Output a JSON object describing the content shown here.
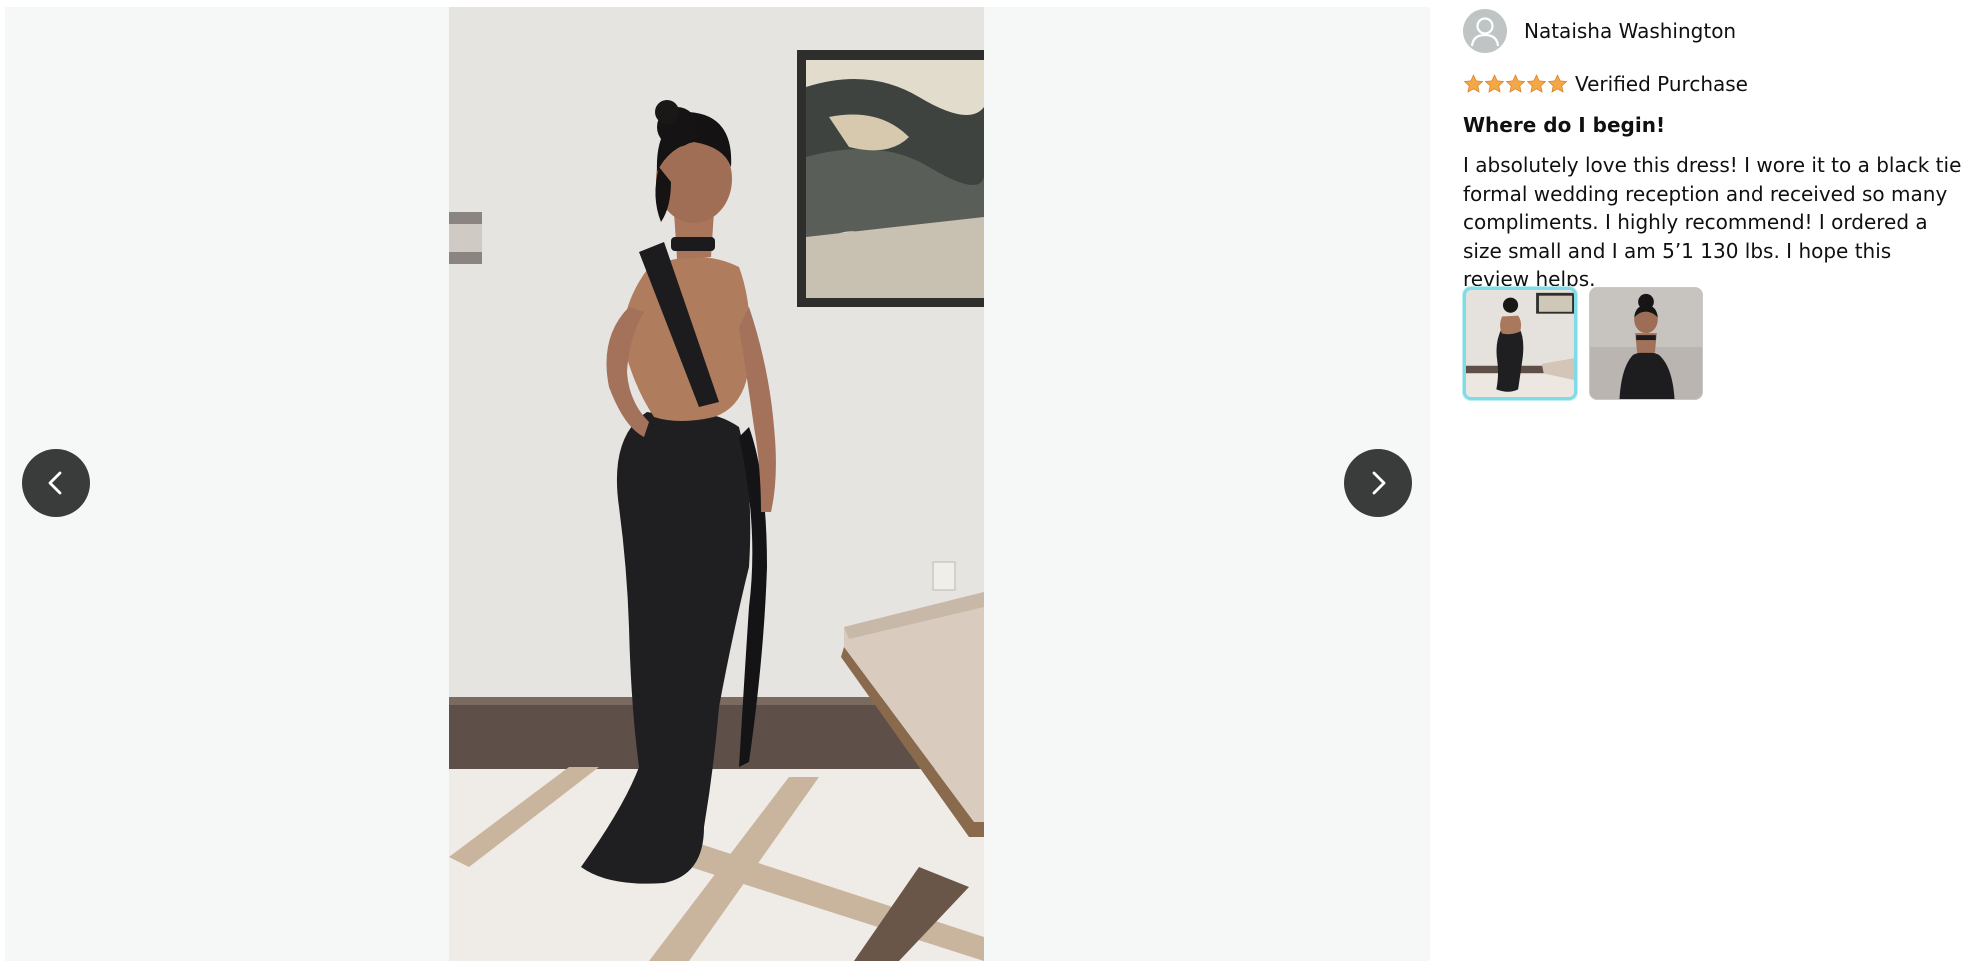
{
  "viewer": {
    "prev_icon": "chevron-left-icon",
    "next_icon": "chevron-right-icon"
  },
  "review": {
    "reviewer_name": "Nataisha Washington",
    "avatar_icon": "user-avatar-icon",
    "rating": 5,
    "rating_max": 5,
    "star_color": "#f3a847",
    "verified_label": "Verified Purchase",
    "title": "Where do I begin!",
    "body": "I absolutely love this dress! I wore it to a black tie formal wedding reception and received so many compliments. I highly recommend! I ordered a size small and I am 5’1 130 lbs. I hope this review helps.",
    "thumbnails": [
      {
        "selected": true
      },
      {
        "selected": false
      }
    ],
    "selected_border_color": "#7fdbe6"
  }
}
